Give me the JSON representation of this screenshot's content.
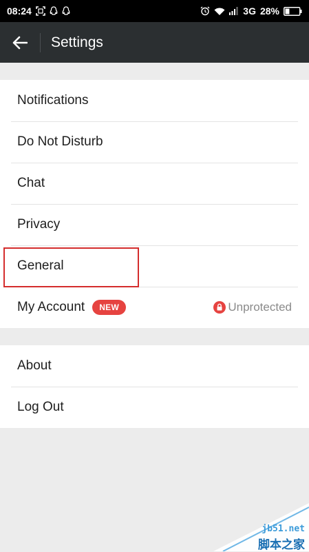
{
  "status_bar": {
    "time": "08:24",
    "network": "3G",
    "battery": "28%",
    "icons_left": [
      "screenshot-icon",
      "qq-icon",
      "qq-icon"
    ],
    "icons_right": [
      "alarm-icon",
      "wifi-icon",
      "signal-icon",
      "battery-icon"
    ]
  },
  "app_bar": {
    "back_icon": "arrow-left-icon",
    "title": "Settings"
  },
  "groups": [
    {
      "items": [
        {
          "label": "Notifications"
        },
        {
          "label": "Do Not Disturb"
        },
        {
          "label": "Chat"
        },
        {
          "label": "Privacy"
        },
        {
          "label": "General",
          "highlighted": true
        },
        {
          "label": "My Account",
          "badge": "NEW",
          "status_icon": "lock-icon",
          "status_text": "Unprotected"
        }
      ]
    },
    {
      "items": [
        {
          "label": "About"
        },
        {
          "label": "Log Out"
        }
      ]
    }
  ],
  "watermark": {
    "line1": "jb51.net",
    "line2": "脚本之家"
  },
  "colors": {
    "status_bar": "#000000",
    "app_bar": "#2b2f31",
    "background": "#ececec",
    "badge": "#e64340",
    "highlight": "#d42c2c"
  }
}
